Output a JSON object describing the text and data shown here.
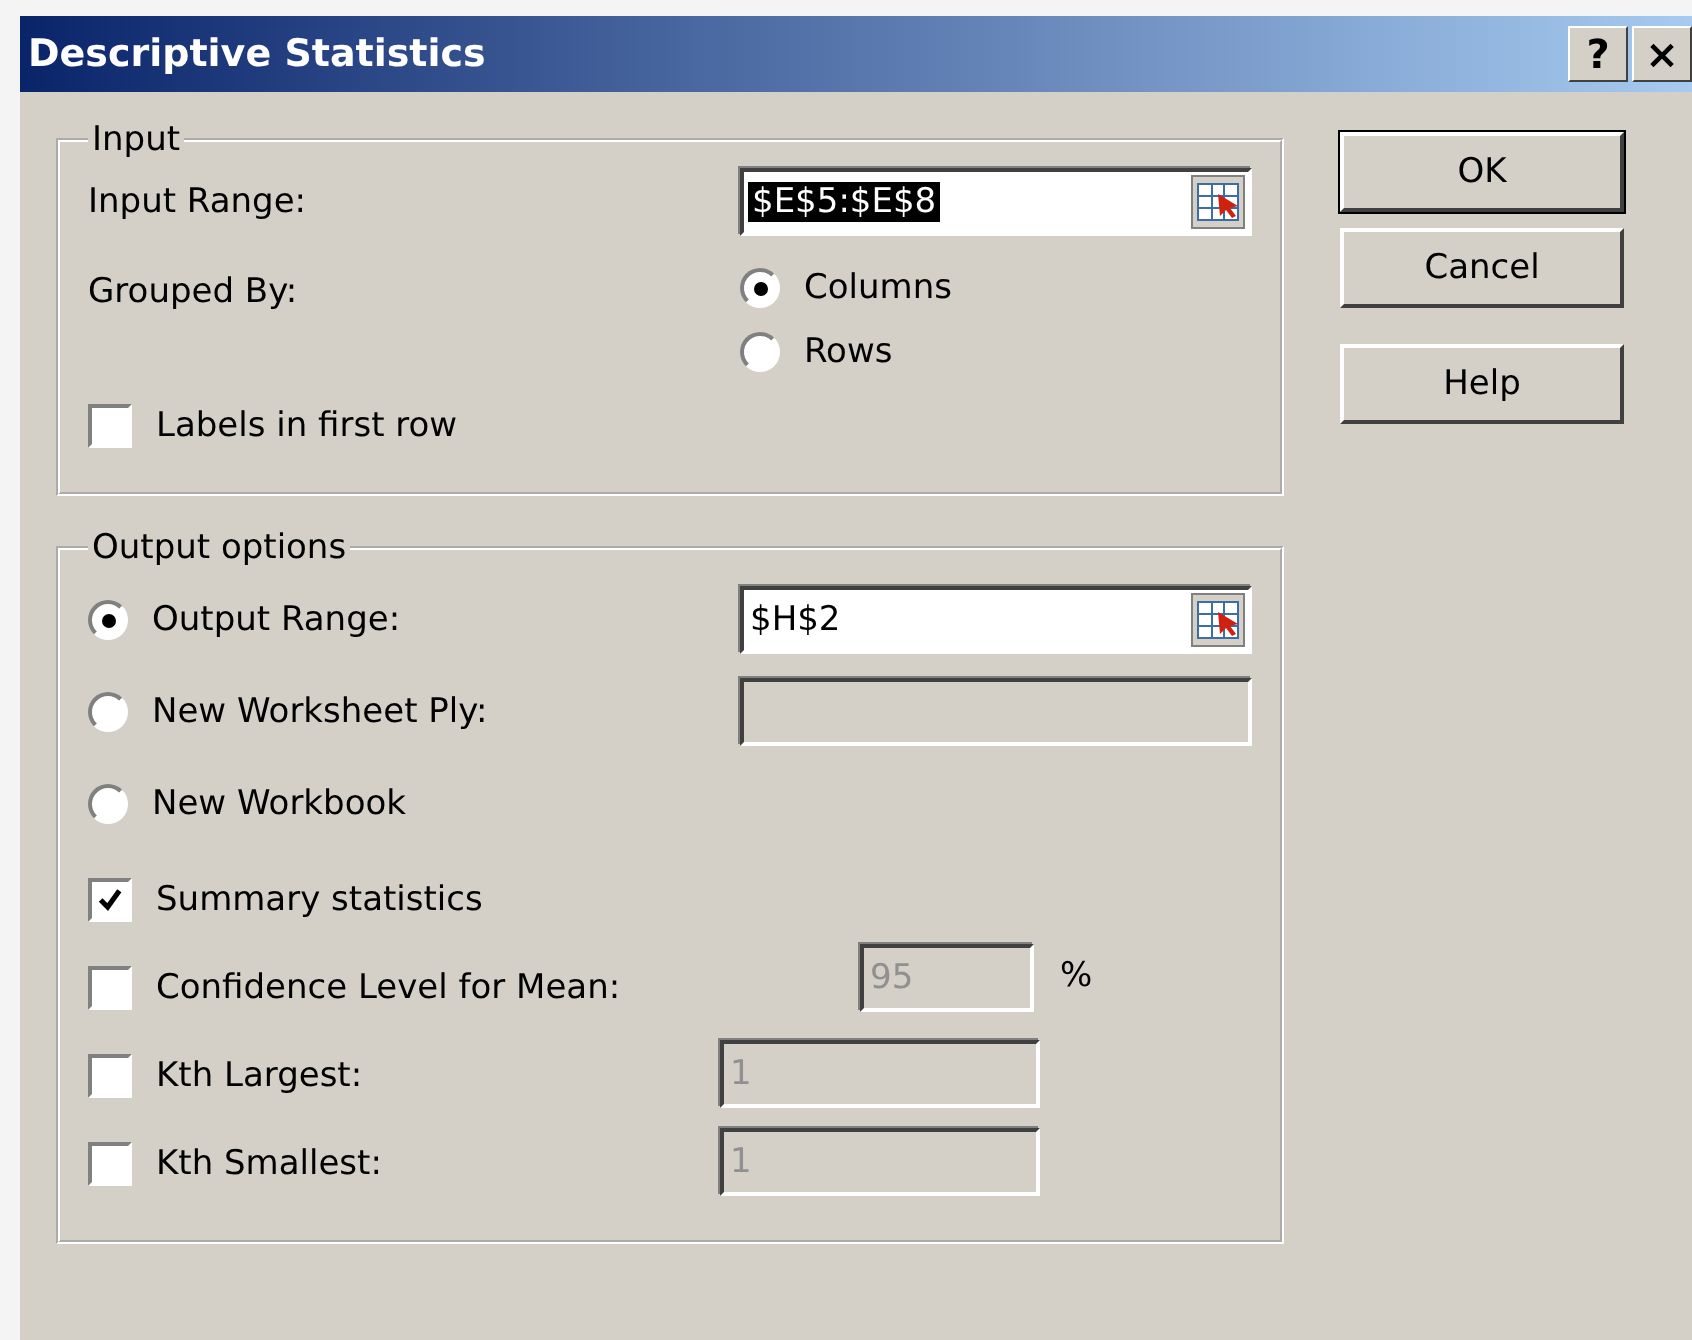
{
  "window": {
    "title": "Descriptive Statistics",
    "title_buttons": [
      "?",
      "×"
    ]
  },
  "input": {
    "legend": "Input",
    "input_range": {
      "label": "Input Range:",
      "value": "$E$5:$E$8",
      "value_selected": true
    },
    "grouped_by": {
      "label": "Grouped By:",
      "options": [
        {
          "label": "Columns",
          "selected": true
        },
        {
          "label": "Rows",
          "selected": false
        }
      ]
    },
    "labels_in_first_row": {
      "label": "Labels in first row",
      "checked": false
    }
  },
  "output": {
    "legend": "Output options",
    "destinations": [
      {
        "label": "Output Range:",
        "selected": true,
        "field": {
          "value": "$H$2",
          "disabled": false,
          "picker": true
        }
      },
      {
        "label": "New Worksheet Ply:",
        "selected": false,
        "field": {
          "disabled": true,
          "picker": false
        }
      },
      {
        "label": "New Workbook",
        "selected": false
      }
    ],
    "options": [
      {
        "label": "Summary statistics",
        "checked": true
      },
      {
        "label": "Confidence Level for Mean:",
        "checked": false,
        "field": {
          "value": "95",
          "disabled": true
        },
        "unit": "%"
      },
      {
        "label": "Kth Largest:",
        "checked": false,
        "field": {
          "value": "1",
          "disabled": true
        }
      },
      {
        "label": "Kth Smallest:",
        "checked": false,
        "field": {
          "value": "1",
          "disabled": true
        }
      }
    ]
  },
  "buttons": [
    {
      "label": "OK",
      "default": true
    },
    {
      "label": "Cancel",
      "default": false
    },
    {
      "label": "Help",
      "default": false
    }
  ]
}
